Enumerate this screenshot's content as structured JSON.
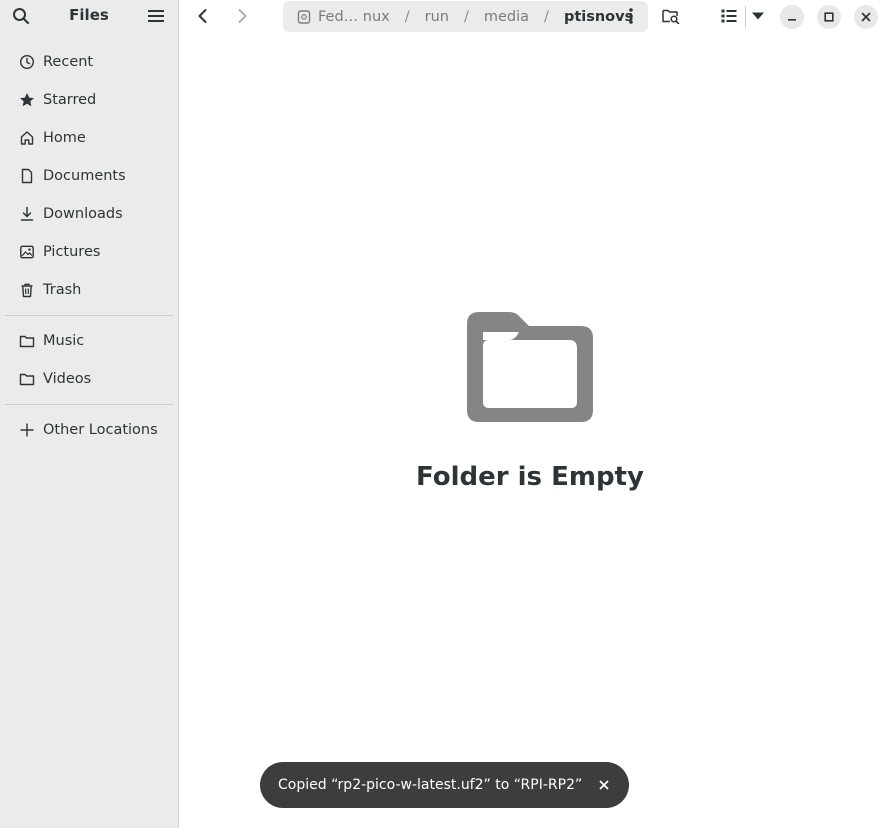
{
  "sidebar": {
    "title": "Files",
    "search_icon": "search-icon",
    "menu_icon": "hamburger-menu-icon",
    "items": [
      {
        "label": "Recent",
        "icon": "clock-icon"
      },
      {
        "label": "Starred",
        "icon": "star-icon"
      },
      {
        "label": "Home",
        "icon": "home-icon"
      },
      {
        "label": "Documents",
        "icon": "document-icon"
      },
      {
        "label": "Downloads",
        "icon": "download-icon"
      },
      {
        "label": "Pictures",
        "icon": "picture-icon"
      },
      {
        "label": "Trash",
        "icon": "trash-icon"
      }
    ],
    "bookmarks": [
      {
        "label": "Music",
        "icon": "folder-icon"
      },
      {
        "label": "Videos",
        "icon": "folder-icon"
      }
    ],
    "other_locations": {
      "label": "Other Locations",
      "icon": "plus-icon"
    }
  },
  "header": {
    "breadcrumbs": [
      {
        "label": "Fed… nux"
      },
      {
        "label": "run"
      },
      {
        "label": "media"
      },
      {
        "label": "ptisnovs"
      }
    ]
  },
  "main": {
    "empty_title": "Folder is Empty"
  },
  "toast": {
    "message": "Copied “rp2-pico-w-latest.uf2” to “RPI-RP2”"
  },
  "colors": {
    "sidebar_bg": "#ebebeb",
    "toast_bg": "#3d3d3d",
    "text": "#2e3436",
    "folder_icon": "#858585"
  }
}
